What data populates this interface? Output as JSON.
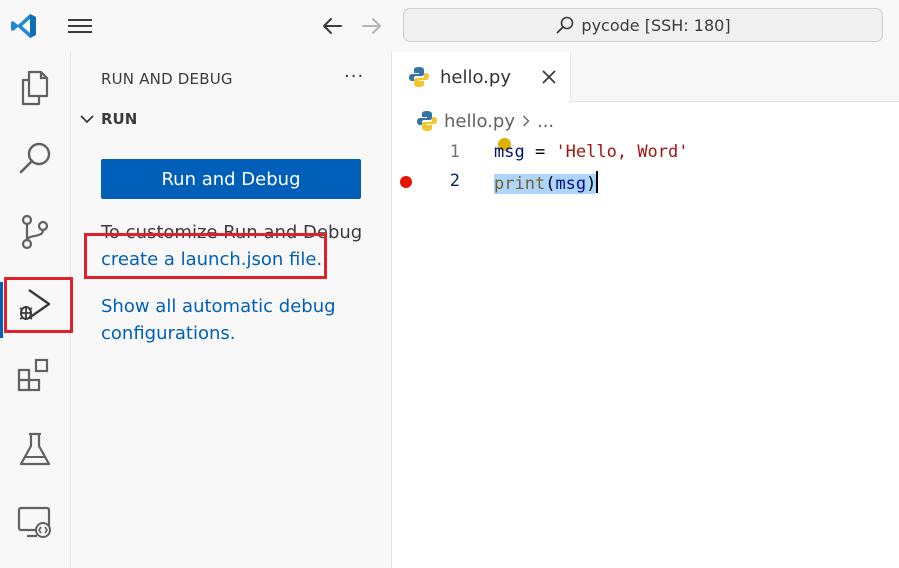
{
  "titlebar": {
    "command_center": "pycode [SSH: 180]"
  },
  "activity_bar": {
    "items": [
      "explorer-icon",
      "search-icon",
      "source-control-icon",
      "run-debug-icon",
      "extensions-icon",
      "testing-icon",
      "remote-explorer-icon"
    ],
    "active": "run-debug-icon"
  },
  "sidebar": {
    "title": "RUN AND DEBUG",
    "more": "···",
    "section": "RUN",
    "run_button": "Run and Debug",
    "customize_text": "To customize Run and Debug",
    "launch_link": "create a launch.json file.",
    "auto_config_line1": "Show all automatic debug",
    "auto_config_line2": "configurations."
  },
  "editor": {
    "tab_label": "hello.py",
    "breadcrumb_file": "hello.py",
    "breadcrumb_more": "...",
    "lines": [
      {
        "number": "1",
        "tokens": [
          {
            "t": "msg",
            "c": "var"
          },
          {
            "t": " = ",
            "c": "op"
          },
          {
            "t": "'Hello, Word'",
            "c": "str"
          }
        ]
      },
      {
        "number": "2",
        "tokens": [
          {
            "t": "print",
            "c": "fn"
          },
          {
            "t": "(",
            "c": "op"
          },
          {
            "t": "msg",
            "c": "var"
          },
          {
            "t": ")",
            "c": "op"
          }
        ],
        "breakpoint": true,
        "selected": true
      }
    ]
  },
  "colors": {
    "accent": "#005fb8",
    "highlight_box": "#e0202a",
    "breakpoint": "#e51400"
  }
}
